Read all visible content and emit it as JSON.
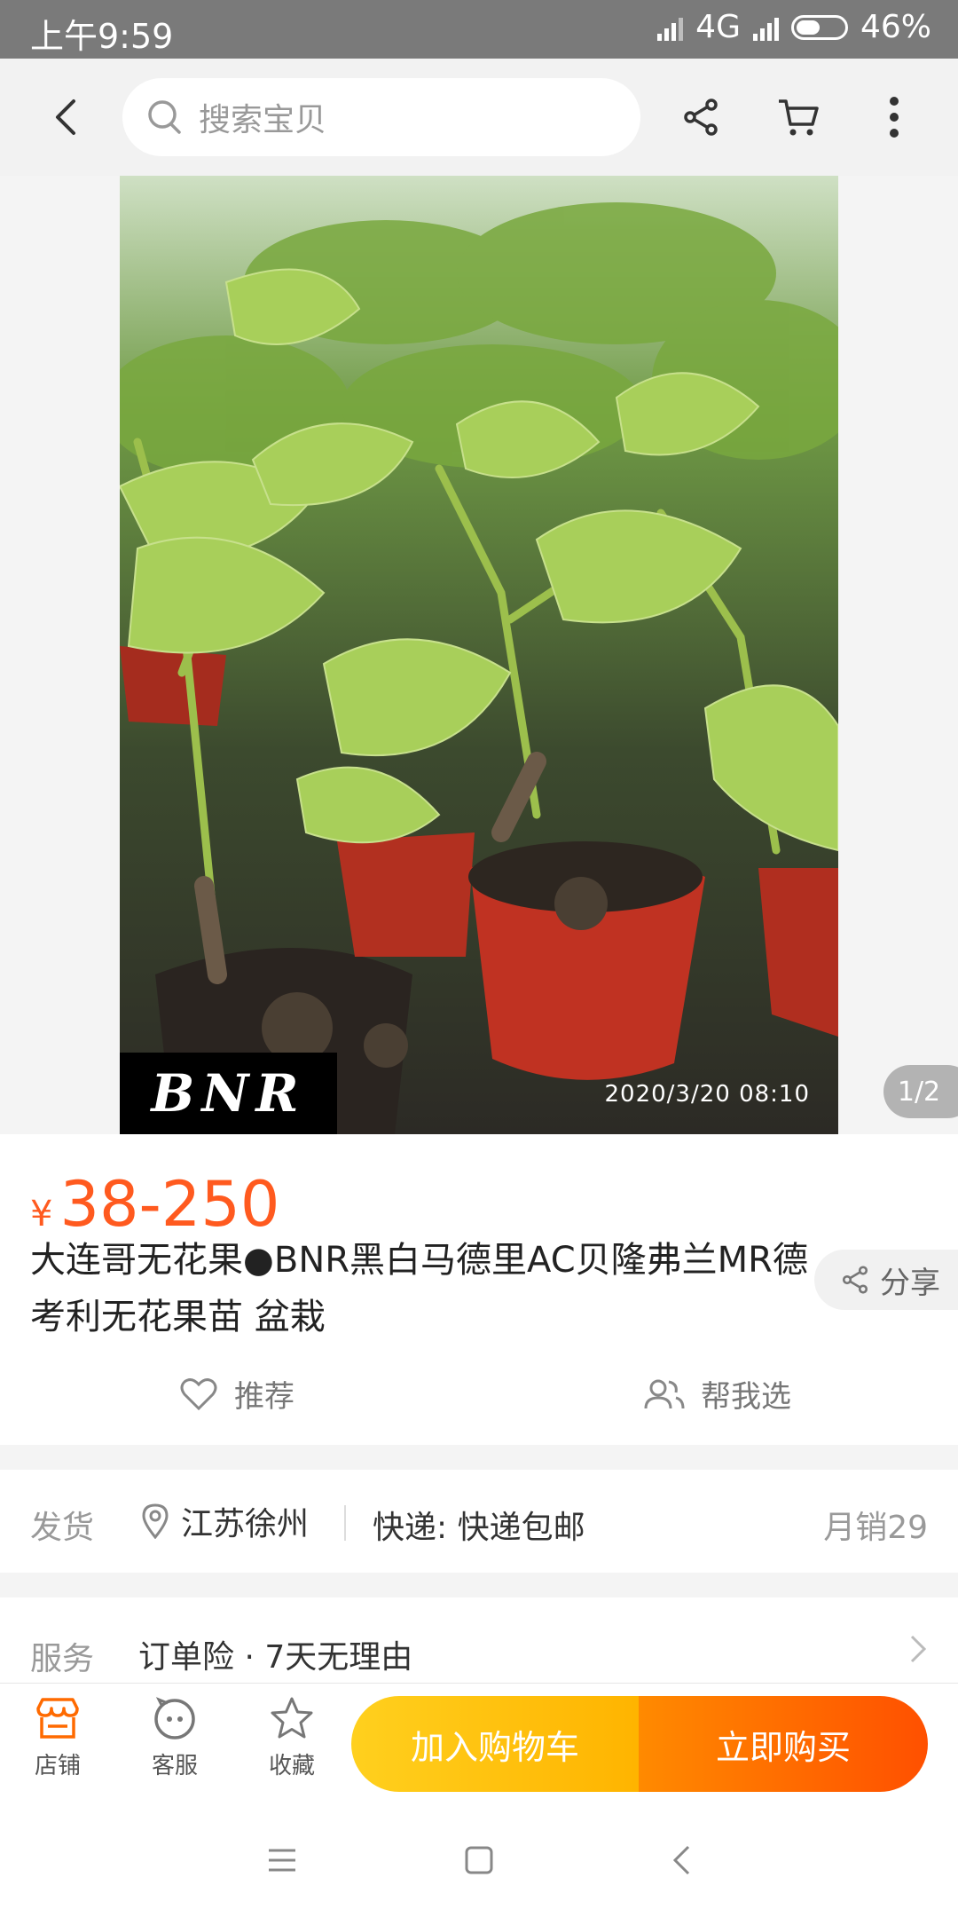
{
  "status_bar": {
    "time": "上午9:59",
    "network": "4G",
    "battery": "46%"
  },
  "header": {
    "search_placeholder": "搜索宝贝",
    "icons": [
      "back-icon",
      "search-icon",
      "share-icon",
      "cart-icon",
      "more-icon"
    ]
  },
  "gallery": {
    "watermark": "BNR",
    "timestamp": "2020/3/20 08:10",
    "counter": "1/2"
  },
  "product": {
    "currency": "¥",
    "price": "38-250",
    "title": "大连哥无花果●BNR黑白马德里AC贝隆弗兰MR德考利无花果苗 盆栽",
    "share_label": "分享",
    "recommend_label": "推荐",
    "help_choose_label": "帮我选"
  },
  "shipping": {
    "label": "发货",
    "location": "江苏徐州",
    "express": "快递: 快递包邮",
    "monthly_sales": "月销29"
  },
  "service": {
    "label": "服务",
    "items": "订单险 · 7天无理由"
  },
  "bottom_bar": {
    "shop_label": "店铺",
    "service_label": "客服",
    "favorite_label": "收藏",
    "add_to_cart": "加入购物车",
    "buy_now": "立即购买"
  },
  "colors": {
    "price": "#ff5a1f",
    "cart_button": "#ffc107",
    "buy_button": "#ff6a00",
    "shop_icon": "#ff6a00"
  }
}
